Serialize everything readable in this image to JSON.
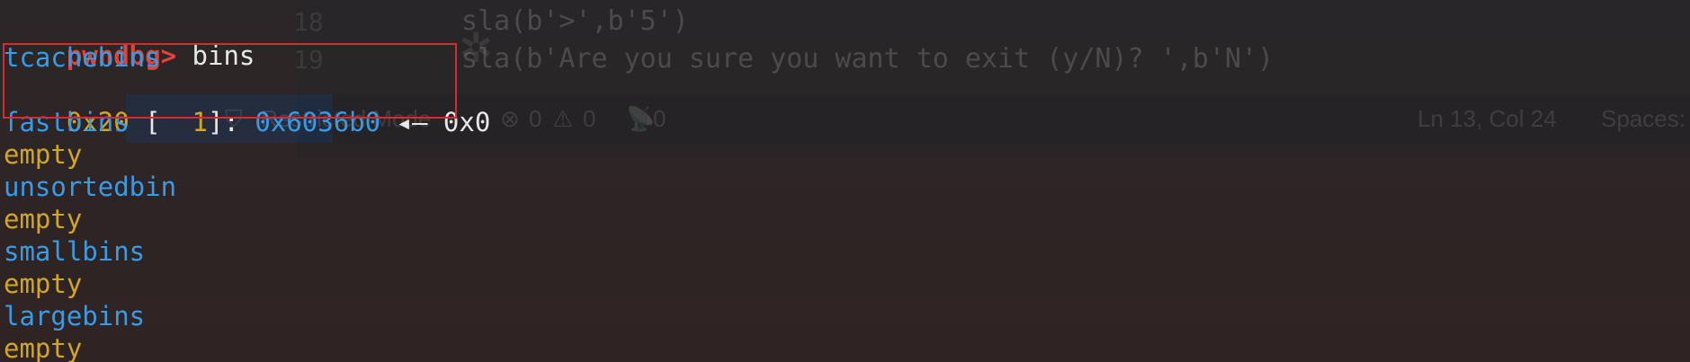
{
  "background_editor": {
    "line_numbers": [
      "18",
      "19"
    ],
    "code_lines": [
      "sla(b'>',b'5')",
      "sla(b'Are you sure you want to exit (y/N)? ',b'N')"
    ],
    "status_bar": {
      "restricted_mode": "Restricted Mode",
      "errors": "0",
      "warnings": "0",
      "ports": "0",
      "cursor": "Ln 13, Col 24",
      "spaces": "Spaces:"
    }
  },
  "terminal": {
    "prompt": "pwndbg>",
    "command": " bins",
    "tcache": {
      "header": "tcachebins",
      "entry_size": "0x20",
      "entry_bracket_open": " [  ",
      "entry_count": "1",
      "entry_bracket_close": "]",
      "entry_colon": ": ",
      "entry_addr": "0x6036b0",
      "entry_arrow": " ◂— ",
      "entry_next": "0x0"
    },
    "bins": [
      {
        "name": "fastbins",
        "value": "empty"
      },
      {
        "name": "unsortedbin",
        "value": "empty"
      },
      {
        "name": "smallbins",
        "value": "empty"
      },
      {
        "name": "largebins",
        "value": "empty"
      }
    ]
  },
  "colors": {
    "prompt": "#e0443b",
    "bin_header": "#3a9be4",
    "empty": "#d3a623",
    "highlight_box": "#d42b35"
  }
}
